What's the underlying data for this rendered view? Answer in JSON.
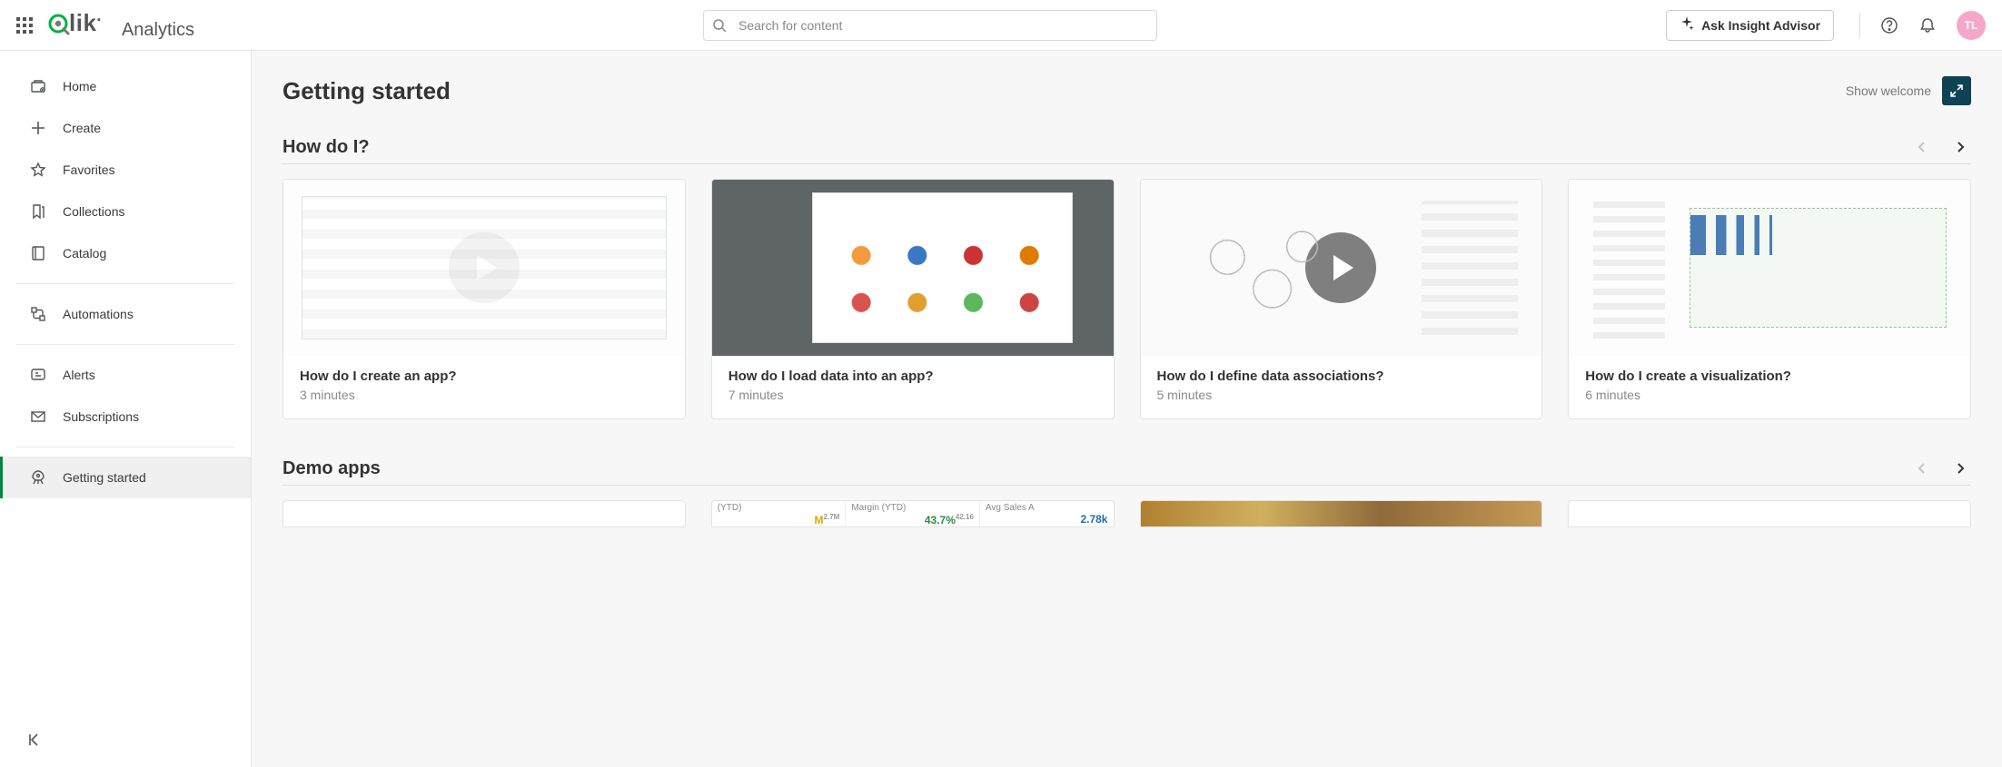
{
  "brand": {
    "logo_text": "Qlik",
    "product": "Analytics"
  },
  "search": {
    "placeholder": "Search for content"
  },
  "insight_button": "Ask Insight Advisor",
  "avatar_initials": "TL",
  "sidebar": {
    "items": [
      {
        "id": "home",
        "label": "Home"
      },
      {
        "id": "create",
        "label": "Create"
      },
      {
        "id": "favorites",
        "label": "Favorites"
      },
      {
        "id": "collections",
        "label": "Collections"
      },
      {
        "id": "catalog",
        "label": "Catalog"
      },
      {
        "id": "automations",
        "label": "Automations"
      },
      {
        "id": "alerts",
        "label": "Alerts"
      },
      {
        "id": "subscriptions",
        "label": "Subscriptions"
      },
      {
        "id": "getting-started",
        "label": "Getting started"
      }
    ],
    "active_id": "getting-started"
  },
  "page": {
    "title": "Getting started",
    "show_welcome_label": "Show welcome"
  },
  "sections": {
    "how_do_i": {
      "title": "How do I?",
      "prev_enabled": false,
      "next_enabled": true,
      "cards": [
        {
          "title": "How do I create an app?",
          "duration": "3 minutes"
        },
        {
          "title": "How do I load data into an app?",
          "duration": "7 minutes"
        },
        {
          "title": "How do I define data associations?",
          "duration": "5 minutes"
        },
        {
          "title": "How do I create a visualization?",
          "duration": "6 minutes"
        }
      ]
    },
    "demo_apps": {
      "title": "Demo apps",
      "prev_enabled": false,
      "next_enabled": true,
      "peek": {
        "metrics": {
          "ytd_label": "(YTD)",
          "margin_label": "Margin (YTD)",
          "margin_value": "43.7%",
          "margin_sub": "42.16",
          "avg_label": "Avg Sales A",
          "avg_value": "2.78k",
          "m_value": "M",
          "m_sub": "2.7M"
        }
      }
    }
  }
}
